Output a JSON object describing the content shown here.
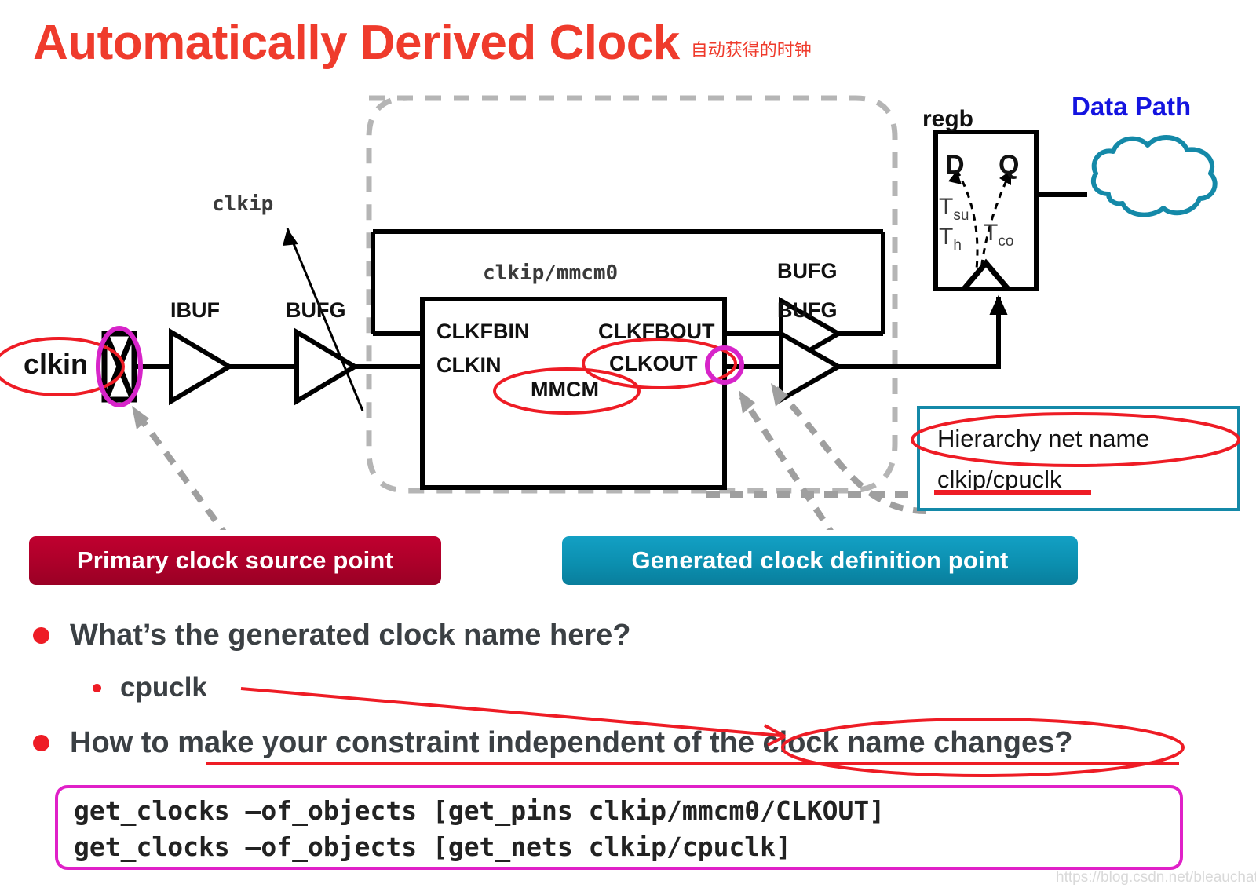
{
  "title": {
    "main": "Automatically Derived Clock",
    "subtitle": "自动获得的时钟",
    "color": "#ef3b2c"
  },
  "diagram": {
    "port_label": "clkin",
    "hierarchy_label": "clkip",
    "mmcm_instance": "clkip/mmcm0",
    "buffers": {
      "ibuf": "IBUF",
      "bufg_input": "BUFG",
      "bufg_feedback": "BUFG",
      "bufg_output": "BUFG"
    },
    "mmcm": {
      "name": "MMCM",
      "pin_clkfbin": "CLKFBIN",
      "pin_clkfbout": "CLKFBOUT",
      "pin_clkin": "CLKIN",
      "pin_clkout": "CLKOUT"
    },
    "register": {
      "name": "regb",
      "pin_d": "D",
      "pin_q": "Q",
      "t_su": "T",
      "t_su_sub": "su",
      "t_h": "T",
      "t_h_sub": "h",
      "t_co": "T",
      "t_co_sub": "co"
    },
    "data_path_label": "Data Path",
    "colors": {
      "highlight_red": "#ee1c25",
      "highlight_magenta": "#e020c8",
      "cloud_teal": "#1489a8",
      "data_path_blue": "#1414e0",
      "boundary_gray": "#b5b5b5"
    }
  },
  "hierarchy_box": {
    "line1": "Hierarchy net name",
    "line2": "clkip/cpuclk",
    "border_color": "#1489a8"
  },
  "banners": {
    "primary": {
      "label": "Primary clock source point",
      "color": "#b00029"
    },
    "generated": {
      "label": "Generated clock definition point",
      "color": "#0b8eae"
    }
  },
  "bullets": [
    {
      "level": 1,
      "text": "What’s the generated clock name here?"
    },
    {
      "level": 2,
      "text": "cpuclk"
    },
    {
      "level": 1,
      "text": "How to make your constraint independent of the clock name changes?"
    }
  ],
  "code": {
    "line1": "get_clocks –of_objects [get_pins clkip/mmcm0/CLKOUT]",
    "line2": "get_clocks –of_objects [get_nets clkip/cpuclk]",
    "border_color": "#e020c8"
  },
  "watermark": "https://blog.csdn.net/bleauchat"
}
